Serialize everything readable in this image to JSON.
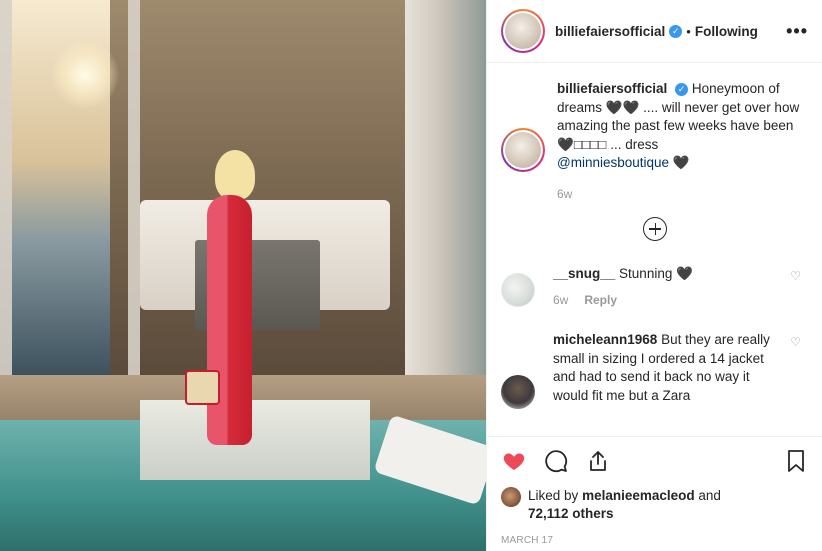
{
  "post": {
    "username": "billiefaiersofficial",
    "verified_icon": "verified-badge-icon",
    "follow_status": "Following",
    "more_icon": "•••"
  },
  "caption": {
    "username": "billiefaiersofficial",
    "text_1": "Honeymoon of dreams 🖤🖤 .... will never get over how amazing the past few weeks have been 🖤",
    "text_boxes": "□□□□",
    "text_2": " ... dress",
    "mention": "@minniesboutique",
    "text_3": " 🖤",
    "time": "6w"
  },
  "comments": [
    {
      "username": "__snug__",
      "text": "Stunning 🖤",
      "time": "6w",
      "reply_label": "Reply"
    },
    {
      "username": "micheleann1968",
      "text": "But they are really small in sizing I ordered a 14 jacket and had to send it back no way it would fit me but a Zara"
    }
  ],
  "actions": {
    "liked_by_prefix": "Liked by",
    "liked_by_user": "melanieemacleod",
    "and": "and",
    "others_count": "72,112 others",
    "date": "MARCH 17"
  },
  "colors": {
    "like_red": "#ed4956",
    "link_blue": "#003569",
    "verified_blue": "#3897f0",
    "meta_gray": "#999999"
  }
}
